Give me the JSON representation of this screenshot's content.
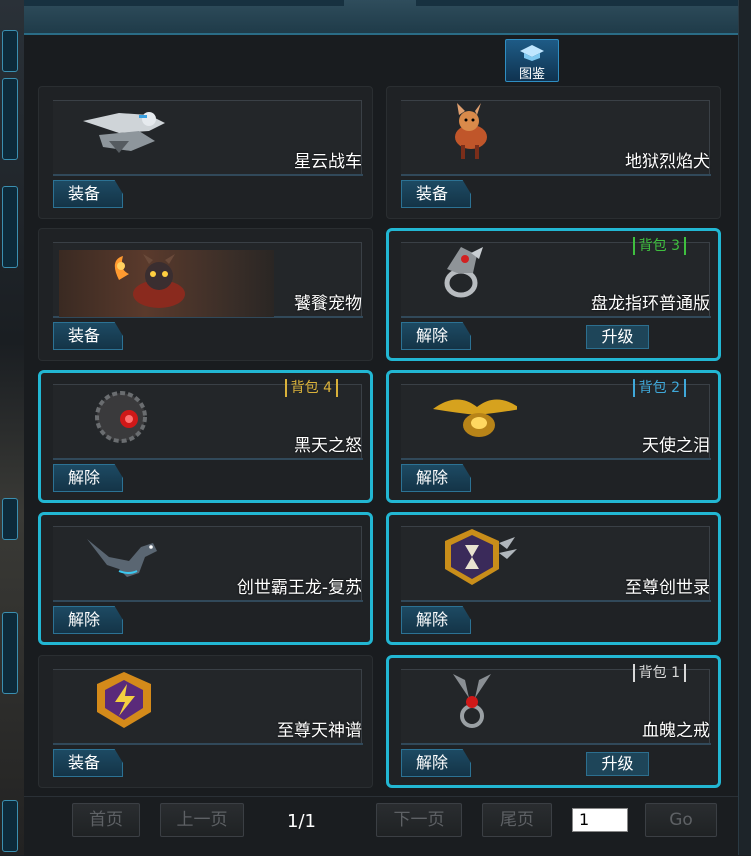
{
  "codex": {
    "label": "图鉴"
  },
  "cards": [
    {
      "name": "星云战车",
      "action": "装备",
      "equipped": false,
      "icon": "nebula-chariot-icon"
    },
    {
      "name": "地狱烈焰犬",
      "action": "装备",
      "equipped": false,
      "icon": "hellfire-hound-icon"
    },
    {
      "name": "饕餮宠物",
      "action": "装备",
      "equipped": false,
      "icon": "taotie-pet-icon"
    },
    {
      "name": "盘龙指环普通版",
      "action": "解除",
      "equipped": true,
      "bag": "背包 3",
      "bag_color": "#3fbf3f",
      "upgrade": "升级",
      "icon": "dragon-ring-icon"
    },
    {
      "name": "黑天之怒",
      "action": "解除",
      "equipped": true,
      "bag": "背包 4",
      "bag_color": "#d9b13a",
      "icon": "dark-sky-orb-icon"
    },
    {
      "name": "天使之泪",
      "action": "解除",
      "equipped": true,
      "bag": "背包 2",
      "bag_color": "#3fa8d9",
      "icon": "angel-tear-ring-icon"
    },
    {
      "name": "创世霸王龙-复苏",
      "action": "解除",
      "equipped": true,
      "icon": "t-rex-pet-icon"
    },
    {
      "name": "至尊创世录",
      "action": "解除",
      "equipped": true,
      "icon": "hourglass-emblem-icon"
    },
    {
      "name": "至尊天神谱",
      "action": "装备",
      "equipped": false,
      "icon": "lightning-emblem-icon"
    },
    {
      "name": "血魄之戒",
      "action": "解除",
      "equipped": true,
      "bag": "背包 1",
      "bag_color": "#d8d8d8",
      "upgrade": "升级",
      "icon": "blood-ring-icon"
    }
  ],
  "pager": {
    "first": "首页",
    "prev": "上一页",
    "indicator": "1/1",
    "next": "下一页",
    "last": "尾页",
    "page_input": "1",
    "go": "Go"
  }
}
